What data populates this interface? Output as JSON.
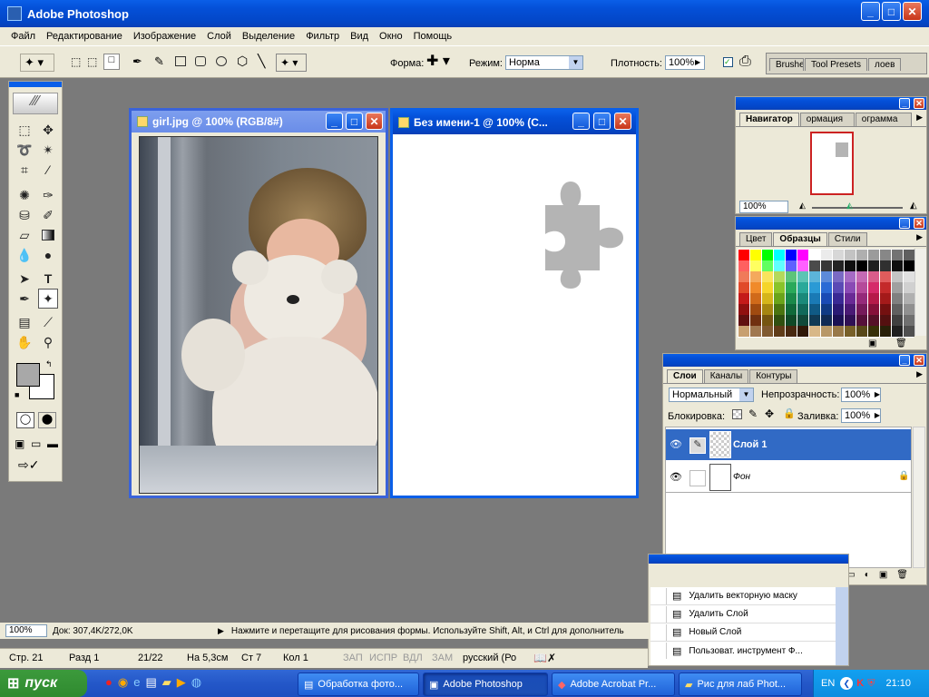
{
  "app": {
    "title": "Adobe Photoshop"
  },
  "menu": [
    "Файл",
    "Редактирование",
    "Изображение",
    "Слой",
    "Выделение",
    "Фильтр",
    "Вид",
    "Окно",
    "Помощь"
  ],
  "options": {
    "shape_label": "Форма:",
    "mode_label": "Режим:",
    "mode_value": "Норма",
    "opacity_label": "Плотность:",
    "opacity_value": "100%",
    "well_tabs": [
      "Brushe",
      "Tool Presets",
      "лоев"
    ]
  },
  "doc1": {
    "title": "girl.jpg @ 100% (RGB/8#)"
  },
  "doc2": {
    "title": "Без имени-1 @ 100% (C..."
  },
  "navigator": {
    "tabs": [
      "Навигатор",
      "ормация",
      "ограмма"
    ],
    "zoom": "100%"
  },
  "swatches": {
    "tabs": [
      "Цвет",
      "Образцы",
      "Стили"
    ],
    "colors": [
      "#ff0000",
      "#ffff00",
      "#00ff00",
      "#00ffff",
      "#0000ff",
      "#ff00ff",
      "#ffffff",
      "#ebebeb",
      "#d7d7d7",
      "#c3c3c3",
      "#afafaf",
      "#9b9b9b",
      "#878787",
      "#737373",
      "#5f5f5f",
      "#ff6060",
      "#ffff60",
      "#60ff60",
      "#60ffff",
      "#6060ff",
      "#ff60ff",
      "#4b4b4b",
      "#373737",
      "#232323",
      "#0f0f0f",
      "#000000",
      "#202020",
      "#303030",
      "#101010",
      "#000000",
      "#f07a5a",
      "#f4a95c",
      "#f9e45c",
      "#b4d95c",
      "#5cc47a",
      "#5cc4b4",
      "#5cb4d9",
      "#5c8ad9",
      "#7a6ac4",
      "#a56ac4",
      "#c46ab4",
      "#d95c8a",
      "#e05c5c",
      "#c4c4c4",
      "#e0e0e0",
      "#e04a2a",
      "#f08a2a",
      "#f5d52a",
      "#8ac42a",
      "#2aa95a",
      "#2aa99a",
      "#2a9ad5",
      "#2a6ad5",
      "#5a4ab5",
      "#8a4ab5",
      "#b54a9a",
      "#d52a6a",
      "#c42a2a",
      "#a0a0a0",
      "#d0d0d0",
      "#c41a1a",
      "#d06a1a",
      "#d5b51a",
      "#6aa41a",
      "#1a894a",
      "#1a897a",
      "#1a7ab5",
      "#1a4ab5",
      "#3a2a95",
      "#6a2a95",
      "#952a7a",
      "#b51a4a",
      "#a41a1a",
      "#808080",
      "#b0b0b0",
      "#901010",
      "#a04a10",
      "#a58510",
      "#4a7410",
      "#10693a",
      "#10695a",
      "#105a85",
      "#103a85",
      "#2a1a75",
      "#4a1a75",
      "#751a5a",
      "#85103a",
      "#741010",
      "#606060",
      "#909090",
      "#601010",
      "#703010",
      "#755510",
      "#305010",
      "#104928",
      "#10493a",
      "#103a55",
      "#102a55",
      "#1a1055",
      "#301055",
      "#55103a",
      "#551028",
      "#541010",
      "#404040",
      "#707070",
      "#c8a070",
      "#a07850",
      "#805a30",
      "#603c18",
      "#482810",
      "#301808",
      "#d8b888",
      "#b89868",
      "#987848",
      "#786028",
      "#584818",
      "#383008",
      "#282008",
      "#202020",
      "#505050"
    ]
  },
  "layers": {
    "tabs": [
      "Слои",
      "Каналы",
      "Контуры"
    ],
    "blend_mode": "Нормальный",
    "opacity_label": "Непрозрачность:",
    "opacity_value": "100%",
    "lock_label": "Блокировка:",
    "fill_label": "Заливка:",
    "fill_value": "100%",
    "items": [
      {
        "name": "Слой 1"
      },
      {
        "name": "Фон"
      }
    ]
  },
  "history": {
    "items": [
      "Удалить векторную маску",
      "Удалить Слой",
      "Новый Слой",
      "Пользоват. инструмент Ф..."
    ]
  },
  "status": {
    "zoom": "100%",
    "doc": "Док: 307,4K/272,0K",
    "hint": "Нажмите и перетащите для рисования формы. Используйте Shift, Alt, и Ctrl для дополнитель"
  },
  "word_status": {
    "page": "Стр. 21",
    "section": "Разд 1",
    "pages": "21/22",
    "at": "На 5,3см",
    "line": "Ст 7",
    "col": "Кол 1",
    "rec": "ЗАП",
    "trk": "ИСПР",
    "ext": "ВДЛ",
    "ovr": "ЗАМ",
    "lang": "русский (Ро"
  },
  "taskbar": {
    "start": "пуск",
    "tasks": [
      "Обработка фото...",
      "Adobe Photoshop",
      "Adobe Acrobat Pr...",
      "Рис для лаб Phot..."
    ],
    "lang": "EN",
    "time": "21:10"
  }
}
